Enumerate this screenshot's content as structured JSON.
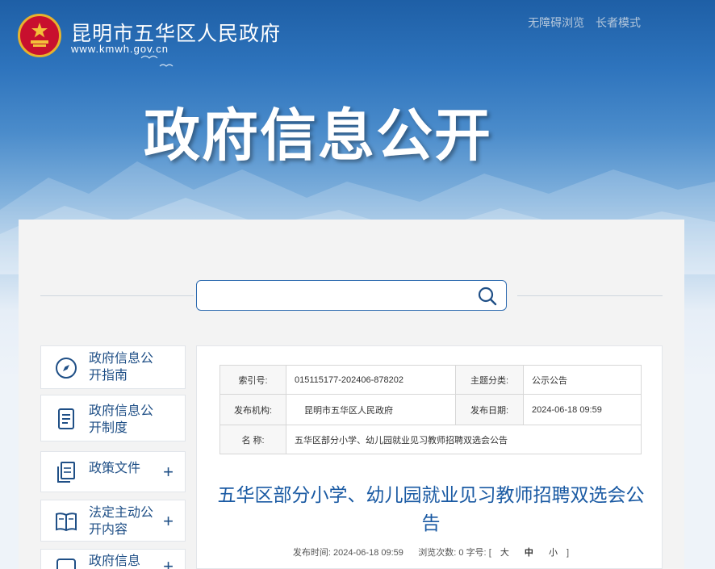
{
  "header": {
    "site_title": "昆明市五华区人民政府",
    "site_url": "www.kmwh.gov.cn",
    "accessibility_link": "无障碍浏览",
    "elder_mode_link": "长者模式",
    "banner_title": "政府信息公开"
  },
  "search": {
    "placeholder": "",
    "value": ""
  },
  "sidebar": {
    "items": [
      {
        "label": "政府信息公开指南",
        "icon": "compass-icon",
        "expandable": false
      },
      {
        "label": "政府信息公开制度",
        "icon": "document-icon",
        "expandable": false
      },
      {
        "label": "政策文件",
        "icon": "file-copy-icon",
        "expandable": true,
        "expand_symbol": "+"
      },
      {
        "label": "法定主动公开内容",
        "icon": "book-icon",
        "expandable": true,
        "expand_symbol": "+"
      },
      {
        "label": "政府信息",
        "icon": "calendar-year-icon",
        "expandable": true,
        "expand_symbol": "+"
      }
    ]
  },
  "meta": {
    "index_label": "索引号:",
    "index_value": "015115177-202406-878202",
    "category_label": "主题分类:",
    "category_value": "公示公告",
    "org_label": "发布机构:",
    "org_value": "昆明市五华区人民政府",
    "date_label": "发布日期:",
    "date_value": "2024-06-18 09:59",
    "name_label": "名 称:",
    "name_value": "五华区部分小学、幼儿园就业见习教师招聘双选会公告"
  },
  "article": {
    "title": "五华区部分小学、幼儿园就业见习教师招聘双选会公告",
    "publish_time_label": "发布时间:",
    "publish_time_value": "2024-06-18 09:59",
    "views_label": "浏览次数:",
    "views_value": "0",
    "font_size_label": "字号:",
    "bracket_open": "[",
    "font_large": "大",
    "font_medium": "中",
    "font_small": "小",
    "bracket_close": "]"
  }
}
